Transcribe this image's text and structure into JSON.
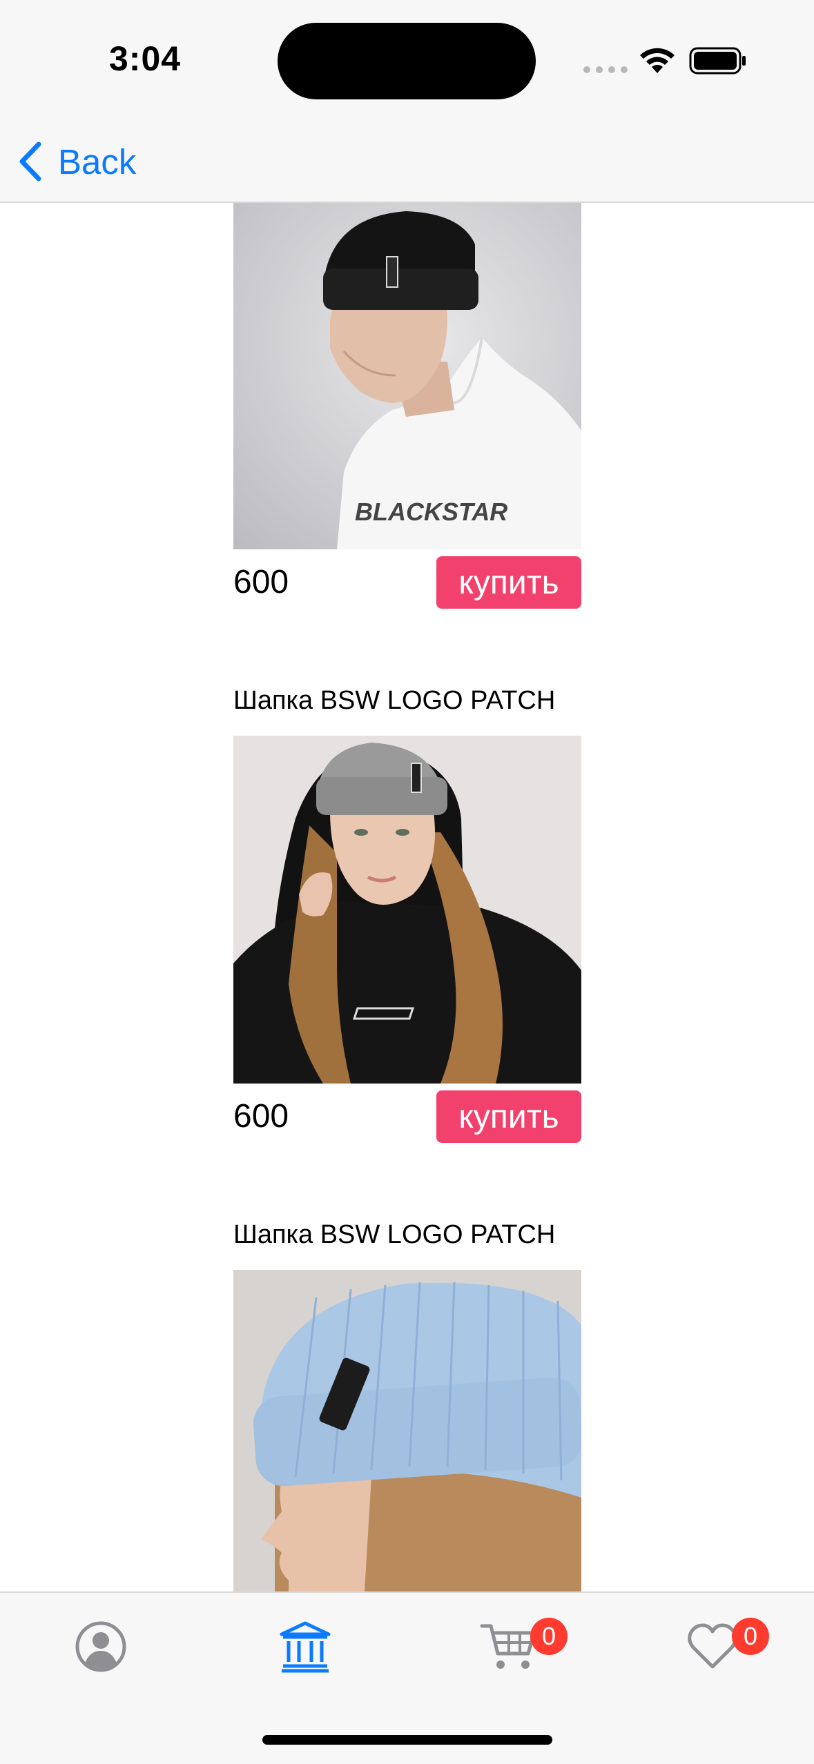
{
  "status_bar": {
    "time": "3:04"
  },
  "nav": {
    "back_label": "Back"
  },
  "products": [
    {
      "title": "",
      "price": "600",
      "buy_label": "купить",
      "image": "man-black-beanie-white-hoodie-photo",
      "hoodie_print": "BLACKSTAR"
    },
    {
      "title": "Шапка BSW LOGO PATCH",
      "price": "600",
      "buy_label": "купить",
      "image": "woman-grey-beanie-black-hoodie-photo"
    },
    {
      "title": "Шапка BSW LOGO PATCH",
      "image": "woman-light-blue-beanie-photo"
    }
  ],
  "tab_bar": {
    "tabs": [
      {
        "icon": "person-circle-icon",
        "active": false
      },
      {
        "icon": "bank-building-icon",
        "active": true
      },
      {
        "icon": "cart-icon",
        "active": false,
        "badge": "0"
      },
      {
        "icon": "heart-icon",
        "active": false,
        "badge": "0"
      }
    ]
  },
  "colors": {
    "accent": "#0a7aff",
    "buy_button": "#f1416c",
    "badge": "#ff3b30",
    "inactive_icon": "#8e8e93"
  }
}
